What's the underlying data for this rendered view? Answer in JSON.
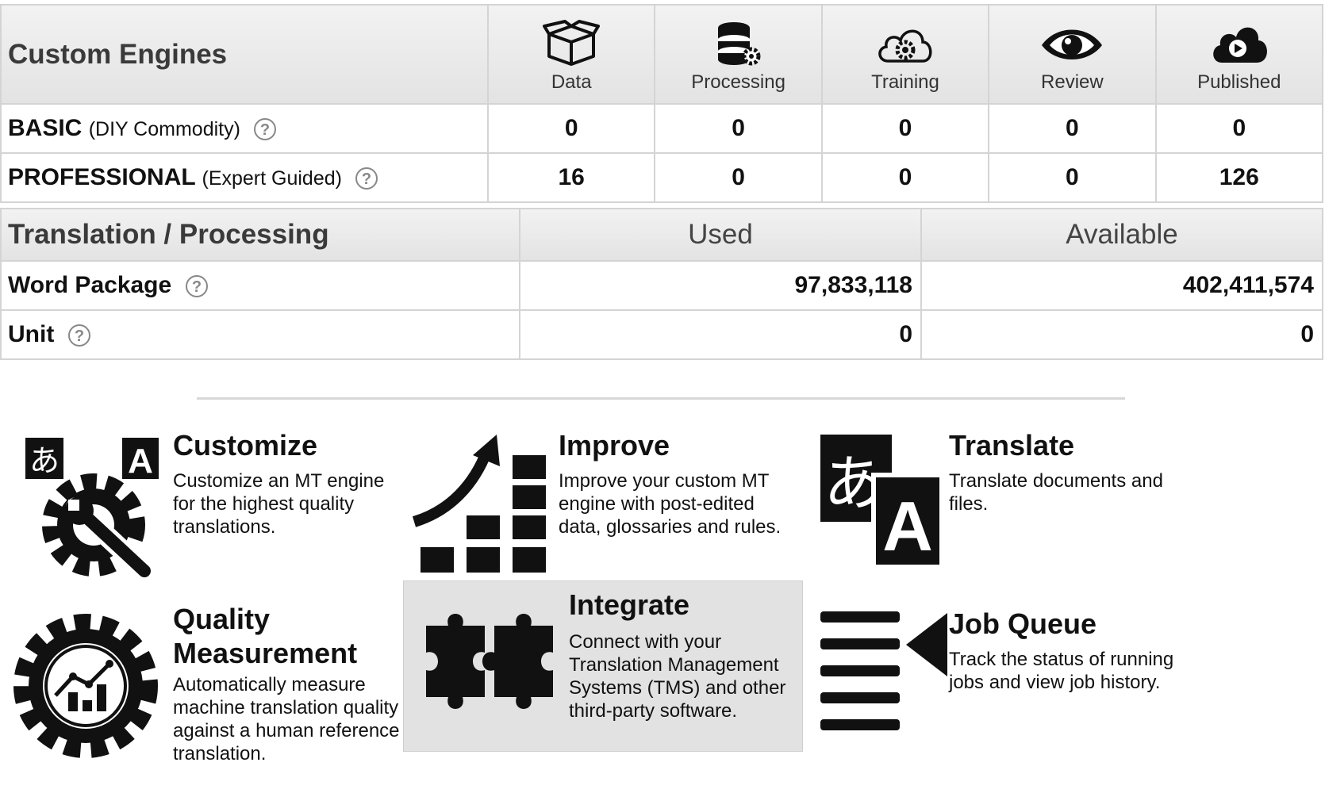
{
  "engines": {
    "title": "Custom Engines",
    "stages": [
      "Data",
      "Processing",
      "Training",
      "Review",
      "Published"
    ],
    "rows": [
      {
        "name": "BASIC",
        "sub": "(DIY Commodity)",
        "values": [
          "0",
          "0",
          "0",
          "0",
          "0"
        ]
      },
      {
        "name": "PROFESSIONAL",
        "sub": "(Expert Guided)",
        "values": [
          "16",
          "0",
          "0",
          "0",
          "126"
        ]
      }
    ]
  },
  "quota": {
    "title": "Translation / Processing",
    "used_label": "Used",
    "available_label": "Available",
    "rows": [
      {
        "name": "Word Package",
        "used": "97,833,118",
        "available": "402,411,574"
      },
      {
        "name": "Unit",
        "used": "0",
        "available": "0"
      }
    ]
  },
  "features": [
    {
      "title": "Customize",
      "desc": "Customize an MT engine for the highest quality translations.",
      "icon": "customize-gear-wrench-icon"
    },
    {
      "title": "Improve",
      "desc": "Improve your custom MT engine with post-edited data, glossaries and rules.",
      "icon": "improve-chart-arrow-icon"
    },
    {
      "title": "Translate",
      "desc": "Translate documents and files.",
      "icon": "translate-language-icon"
    },
    {
      "title": "Quality Measurement",
      "desc": "Automatically measure machine translation quality against a human reference translation.",
      "icon": "quality-gear-chart-icon"
    },
    {
      "title": "Integrate",
      "desc": "Connect with your Translation Management Systems (TMS) and other third-party software.",
      "icon": "puzzle-icon"
    },
    {
      "title": "Job Queue",
      "desc": "Track the status of running jobs and view job history.",
      "icon": "job-queue-list-icon"
    }
  ],
  "glyphs": {
    "hiragana": "あ",
    "latin": "A",
    "help": "?"
  },
  "colors": {
    "header_bg": "#e8e8e8",
    "border": "#d4d4d4",
    "highlight": "#e2e2e2",
    "text": "#111111"
  }
}
